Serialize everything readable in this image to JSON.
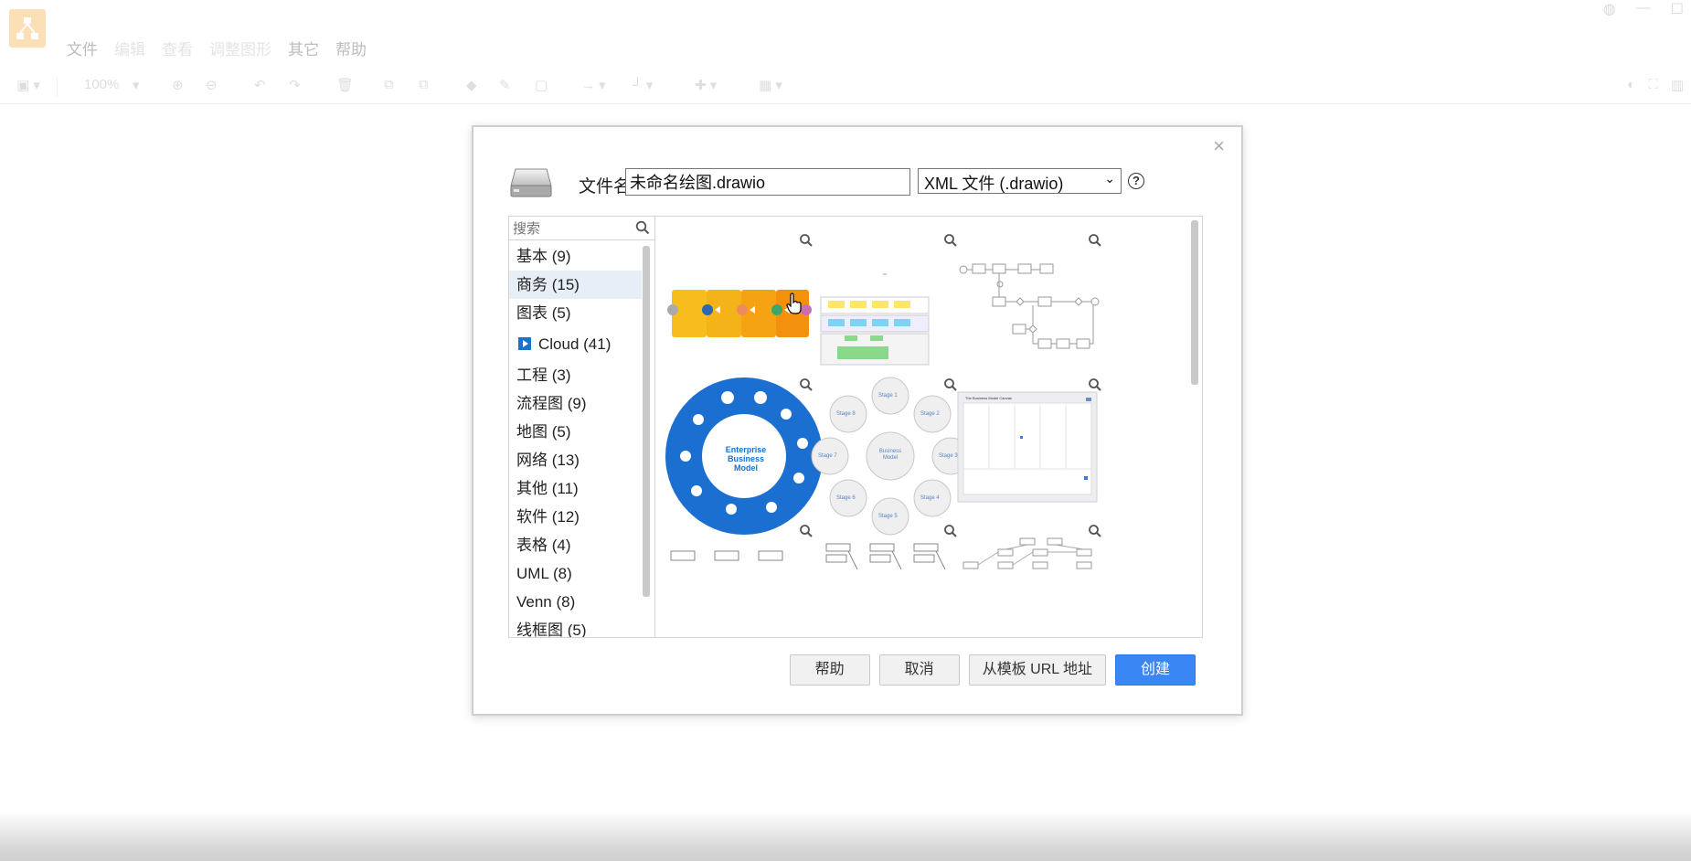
{
  "menu": {
    "items": [
      "文件",
      "编辑",
      "查看",
      "调整图形",
      "其它",
      "帮助"
    ]
  },
  "toolbar": {
    "zoom": "100%"
  },
  "dialog": {
    "filename_label": "文件名:",
    "filename_value": "未命名绘图.drawio",
    "format_selected": "XML 文件 (.drawio)",
    "help_symbol": "?",
    "close_symbol": "×",
    "search_placeholder": "搜索",
    "categories": [
      "基本 (9)",
      "商务 (15)",
      "图表 (5)",
      "Cloud (41)",
      "工程 (3)",
      "流程图 (9)",
      "地图 (5)",
      "网络 (13)",
      "其他 (11)",
      "软件 (12)",
      "表格 (4)",
      "UML (8)",
      "Venn (8)",
      "线框图 (5)"
    ],
    "active_category": "商务 (15)",
    "templates": {
      "enterprise": [
        "Enterprise",
        "Business",
        "Model"
      ],
      "business_model": [
        "Business",
        "Model"
      ],
      "stages": [
        "Stage 1",
        "Stage 2",
        "Stage 3",
        "Stage 4",
        "Stage 5",
        "Stage 6",
        "Stage 7",
        "Stage 8"
      ],
      "canvas_title": "The Business Model Canvas"
    },
    "buttons": {
      "help": "帮助",
      "cancel": "取消",
      "from_url": "从模板 URL 地址",
      "create": "创建"
    }
  },
  "colors": {
    "primary_button": "#3b86f5",
    "active_category_bg": "#e8eef7",
    "enterprise_blue": "#1a6fd0",
    "chevron_orange": "#f5a623",
    "logo": "#f3a533"
  }
}
